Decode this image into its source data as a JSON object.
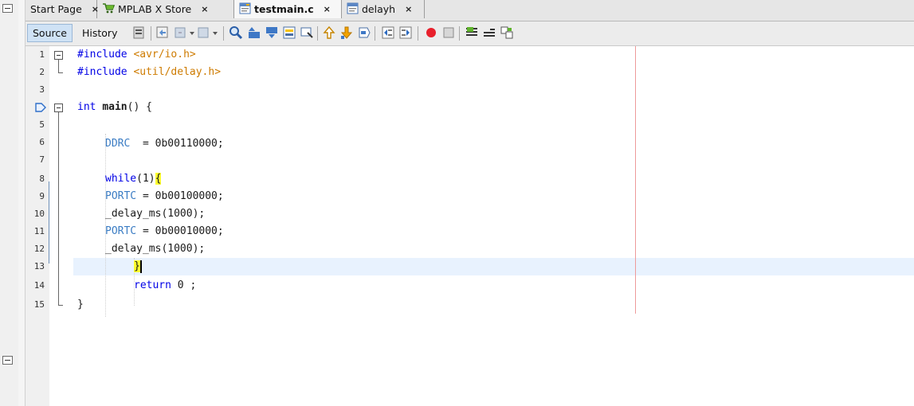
{
  "tabs": [
    {
      "label": "Start Page",
      "close": "×",
      "icon": "",
      "active": false
    },
    {
      "label": "MPLAB X Store",
      "close": "×",
      "icon": "cart-icon",
      "active": false
    },
    {
      "label": "testmain.c",
      "close": "×",
      "icon": "c-file-icon",
      "active": true
    },
    {
      "label": "delayh",
      "close": "×",
      "icon": "h-file-icon",
      "active": false
    }
  ],
  "toolbar": {
    "source_label": "Source",
    "history_label": "History"
  },
  "editor": {
    "line_numbers": [
      "1",
      "2",
      "3",
      "4",
      "5",
      "6",
      "7",
      "8",
      "9",
      "10",
      "11",
      "12",
      "13",
      "14",
      "15"
    ],
    "lines": {
      "l1_kw": "#include",
      "l1_str": "<avr/io.h>",
      "l2_kw": "#include",
      "l2_str": "<util/delay.h>",
      "l4_kw": "int",
      "l4_fn": "main",
      "l4_rest": "() {",
      "l6_ident": "DDRC",
      "l6_rest": "  = 0b00110000;",
      "l8_kw": "while",
      "l8_rest": "(1)",
      "l8_brace": "{",
      "l9_ident": "PORTC",
      "l9_rest": " = 0b00100000;",
      "l10": "_delay_ms(1000);",
      "l11_ident": "PORTC",
      "l11_rest": " = 0b00010000;",
      "l12": "_delay_ms(1000);",
      "l13_brace": "}",
      "l14_kw": "return",
      "l14_rest": " 0 ;",
      "l15": "}"
    }
  },
  "colors": {
    "keyword": "#0000e6",
    "string": "#ce7b00",
    "identifier": "#3c7dc4",
    "bracket_highlight": "#ffff2f",
    "current_line": "#e8f2fe",
    "right_margin": "#ee9a9a"
  }
}
